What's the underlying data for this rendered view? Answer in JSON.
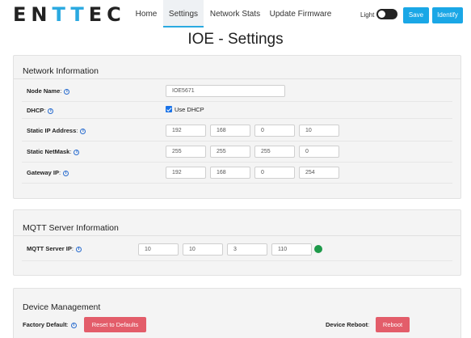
{
  "brand": {
    "logo_left": "EN",
    "logo_accent": "TT",
    "logo_right": "EC",
    "accent_color": "#2aa9e0"
  },
  "nav": {
    "tabs": [
      {
        "label": "Home",
        "active": false
      },
      {
        "label": "Settings",
        "active": true
      },
      {
        "label": "Network Stats",
        "active": false
      },
      {
        "label": "Update Firmware",
        "active": false
      }
    ],
    "theme_label": "Light",
    "save_label": "Save",
    "identify_label": "Identify"
  },
  "page": {
    "title": "IOE - Settings"
  },
  "network": {
    "title": "Network Information",
    "node_name": {
      "label": "Node Name",
      "value": "IOE5671"
    },
    "dhcp": {
      "label": "DHCP",
      "checkbox_label": "Use DHCP",
      "checked": true
    },
    "static_ip": {
      "label": "Static IP Address",
      "octets": [
        "192",
        "168",
        "0",
        "10"
      ]
    },
    "netmask": {
      "label": "Static NetMask",
      "octets": [
        "255",
        "255",
        "255",
        "0"
      ]
    },
    "gateway": {
      "label": "Gateway IP",
      "octets": [
        "192",
        "168",
        "0",
        "254"
      ]
    }
  },
  "mqtt": {
    "title": "MQTT Server Information",
    "server_ip": {
      "label": "MQTT Server IP",
      "octets": [
        "10",
        "10",
        "3",
        "110"
      ]
    },
    "status_color": "#1e9a4a"
  },
  "device": {
    "title": "Device Management",
    "factory_label": "Factory Default",
    "reset_label": "Reset to Defaults",
    "reboot_label": "Device Reboot",
    "reboot_button": "Reboot",
    "danger_color": "#e35d6a"
  },
  "icons": {
    "info": "info-icon",
    "toggle": "toggle-switch-icon",
    "status": "connection-status-icon"
  }
}
